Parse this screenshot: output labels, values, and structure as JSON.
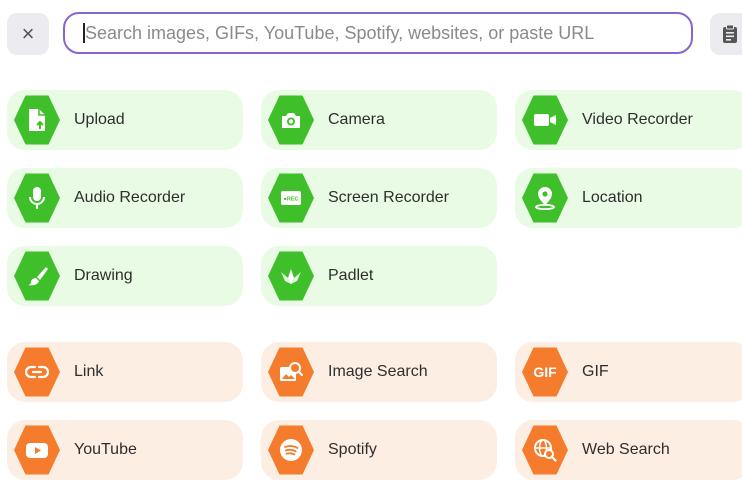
{
  "close": {
    "glyph": "×"
  },
  "search": {
    "placeholder": "Search images, GIFs, YouTube, Spotify, websites, or paste URL",
    "value": ""
  },
  "paste": {
    "icon": "clipboard-icon"
  },
  "colors": {
    "accent": "#8a63d2",
    "green": "#3fbf2a",
    "green_bg": "#e9fbe5",
    "orange": "#f47c2c",
    "orange_bg": "#fdeee4"
  },
  "tiles": {
    "upload": {
      "label": "Upload",
      "icon": "upload-icon"
    },
    "camera": {
      "label": "Camera",
      "icon": "camera-icon"
    },
    "video_recorder": {
      "label": "Video Recorder",
      "icon": "video-camera-icon"
    },
    "audio_recorder": {
      "label": "Audio Recorder",
      "icon": "microphone-icon"
    },
    "screen_recorder": {
      "label": "Screen Recorder",
      "icon": "screen-rec-icon",
      "badge": "●REC"
    },
    "location": {
      "label": "Location",
      "icon": "map-pin-icon"
    },
    "drawing": {
      "label": "Drawing",
      "icon": "paintbrush-icon"
    },
    "padlet": {
      "label": "Padlet",
      "icon": "padlet-logo-icon"
    },
    "link": {
      "label": "Link",
      "icon": "link-icon"
    },
    "image_search": {
      "label": "Image Search",
      "icon": "image-search-icon"
    },
    "gif": {
      "label": "GIF",
      "icon": "gif-icon",
      "badge": "GIF"
    },
    "youtube": {
      "label": "YouTube",
      "icon": "youtube-icon"
    },
    "spotify": {
      "label": "Spotify",
      "icon": "spotify-icon"
    },
    "web_search": {
      "label": "Web Search",
      "icon": "web-search-icon"
    }
  }
}
